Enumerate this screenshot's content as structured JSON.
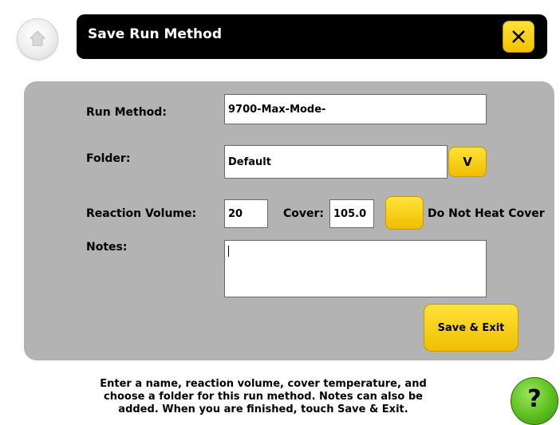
{
  "header": {
    "title": "Save Run Method",
    "home_icon": "home-icon",
    "close_icon": "close-icon"
  },
  "form": {
    "run_method_label": "Run Method:",
    "run_method_value": "9700-Max-Mode-",
    "folder_label": "Folder:",
    "folder_value": "Default",
    "folder_dropdown_label": "V",
    "reaction_volume_label": "Reaction Volume:",
    "reaction_volume_value": "20",
    "cover_label": "Cover:",
    "cover_value": "105.0",
    "do_not_heat_label": "Do Not Heat Cover",
    "notes_label": "Notes:",
    "notes_value": "",
    "save_exit_label": "Save & Exit"
  },
  "footer": {
    "help_text": "Enter a name, reaction volume, cover temperature, and choose a folder for this run method. Notes can also be added. When you are finished, touch Save & Exit.",
    "help_button_label": "?"
  },
  "colors": {
    "accent_yellow": "#f5c800",
    "panel_gray": "#b3b3b3",
    "help_green": "#5cbf1f",
    "title_bar": "#000000"
  }
}
